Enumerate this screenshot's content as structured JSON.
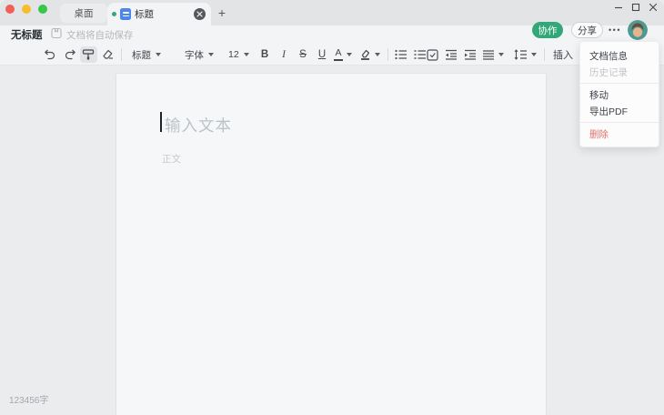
{
  "tabbar": {
    "tab_desktop": "桌面",
    "tab_document": "标题",
    "new_tab": "+"
  },
  "header": {
    "title": "无标题",
    "autosave": "文档将自动保存",
    "collaborate": "协作",
    "share": "分享",
    "more": "•••"
  },
  "toolbar": {
    "heading": "标题",
    "font": "字体",
    "size": "12",
    "bold": "B",
    "italic": "I",
    "strikethrough": "S",
    "underline": "U",
    "font_color": "A",
    "insert": "插入"
  },
  "editor": {
    "title_placeholder": "输入文本",
    "body_placeholder": "正文",
    "word_count": "123456字"
  },
  "menu": {
    "doc_info": "文档信息",
    "history": "历史记录",
    "move": "移动",
    "export_pdf": "导出PDF",
    "delete": "删除"
  },
  "colors": {
    "accent_green": "#34a779",
    "doc_icon_blue": "#4b87ea",
    "danger_red": "#e4736c",
    "traffic_red": "#f15f57",
    "traffic_yellow": "#f8bd2d",
    "traffic_green": "#35c748"
  }
}
